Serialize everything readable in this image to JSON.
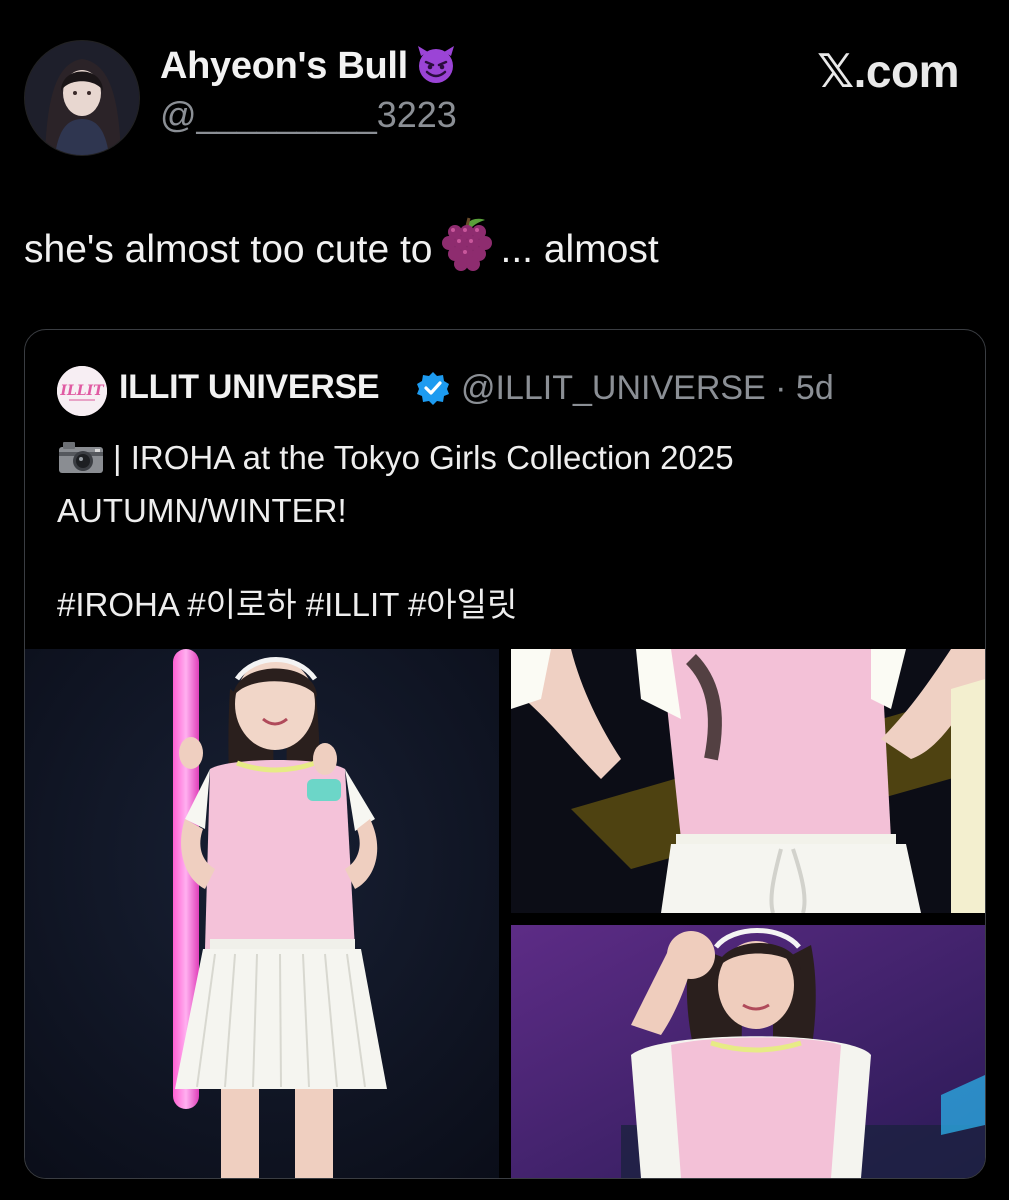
{
  "post": {
    "author_name": "Ahyeon's Bull",
    "author_emoji_icon": "smiling-devil-icon",
    "handle": "@_________3223",
    "brand": "𝕏.com",
    "text_before": "she's almost too cute to",
    "text_emoji_icon": "grapes-icon",
    "text_after": "... almost"
  },
  "quoted": {
    "account_name": "ILLIT UNIVERSE",
    "verified_icon": "verified-badge-icon",
    "meta": "@ILLIT_UNIVERSE · 5d",
    "line1": "| IROHA at the Tokyo Girls Collection 2025",
    "line2": "AUTUMN/WINTER!",
    "hashtags": "#IROHA #이로하 #ILLIT #아일릿",
    "avatar_logo_text": "ILLIT"
  },
  "colors": {
    "background": "#000000",
    "text": "#e7e9ea",
    "muted": "#8b8f95",
    "border": "#3a3d42",
    "verified": "#1d9bf0",
    "accent_pink": "#f2b8d6"
  }
}
